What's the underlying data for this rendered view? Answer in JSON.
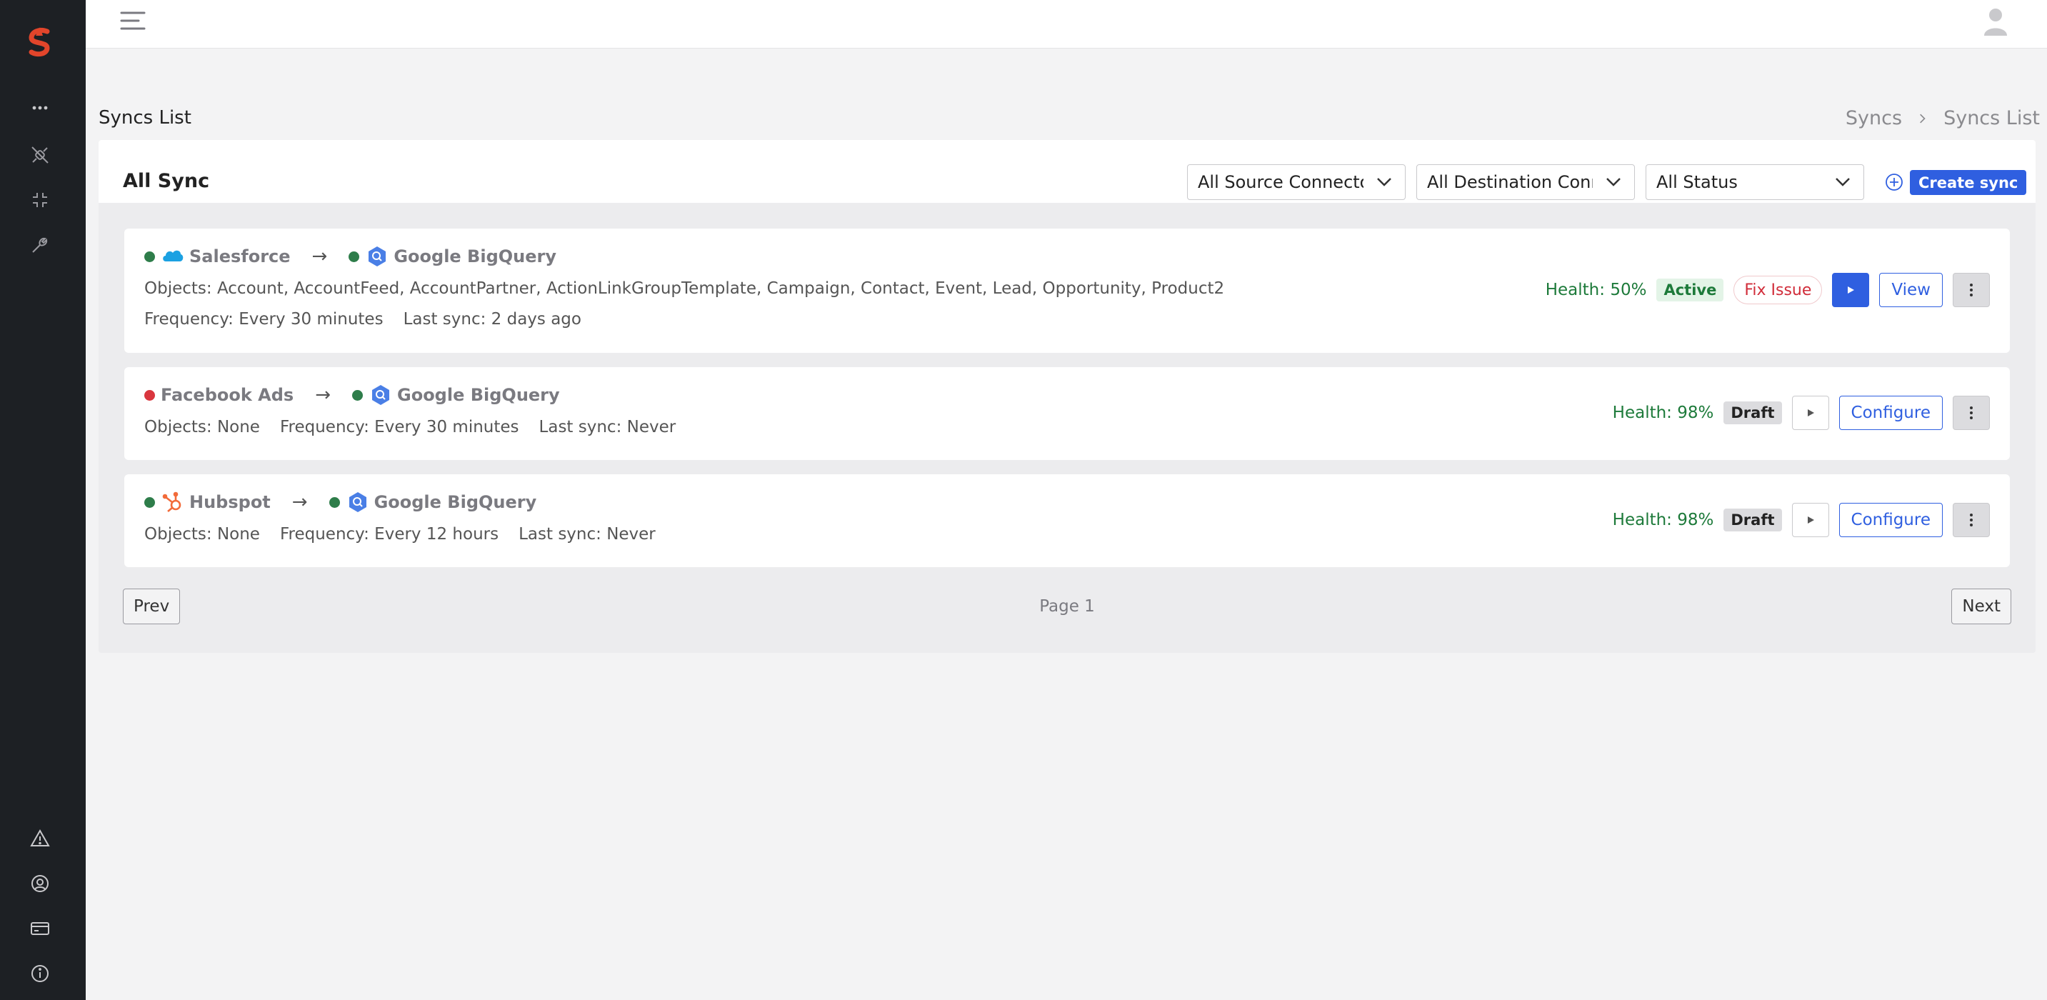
{
  "header": {
    "page_title": "Syncs List",
    "breadcrumb": [
      "Syncs",
      "Syncs List"
    ]
  },
  "sidebar": {
    "icons": [
      "more-icon",
      "plug-icon",
      "collapse-icon",
      "wrench-icon",
      "warning-icon",
      "user-settings-icon",
      "billing-card-icon",
      "info-icon"
    ]
  },
  "panel": {
    "title": "All Sync",
    "filters": {
      "source": "All Source Connectors",
      "destination": "All Destination Connectors",
      "status": "All Status"
    },
    "create_label": "Create sync"
  },
  "syncs": [
    {
      "source": "Salesforce",
      "source_status": "green",
      "destination": "Google BigQuery",
      "destination_status": "green",
      "objects": "Objects: Account, AccountFeed, AccountPartner, ActionLinkGroupTemplate, Campaign, Contact, Event, Lead, Opportunity, Product2",
      "frequency": "Frequency: Every 30 minutes",
      "last_sync": "Last sync: 2 days ago",
      "health": "Health: 50%",
      "status": "Active",
      "fix_label": "Fix Issue",
      "action_label": "View"
    },
    {
      "source": "Facebook Ads",
      "source_status": "red",
      "destination": "Google BigQuery",
      "destination_status": "green",
      "objects": "Objects: None",
      "frequency": "Frequency: Every 30 minutes",
      "last_sync": "Last sync: Never",
      "health": "Health: 98%",
      "status": "Draft",
      "action_label": "Configure"
    },
    {
      "source": "Hubspot",
      "source_status": "green",
      "destination": "Google BigQuery",
      "destination_status": "green",
      "objects": "Objects: None",
      "frequency": "Frequency: Every 12 hours",
      "last_sync": "Last sync: Never",
      "health": "Health: 98%",
      "status": "Draft",
      "action_label": "Configure"
    }
  ],
  "pagination": {
    "prev": "Prev",
    "page": "Page 1",
    "next": "Next"
  },
  "colors": {
    "accent": "#2f5fe0",
    "sidebar": "#1d2024",
    "healthy": "#1d7a3a",
    "error": "#d12d3a",
    "logo": "#e2452b"
  }
}
